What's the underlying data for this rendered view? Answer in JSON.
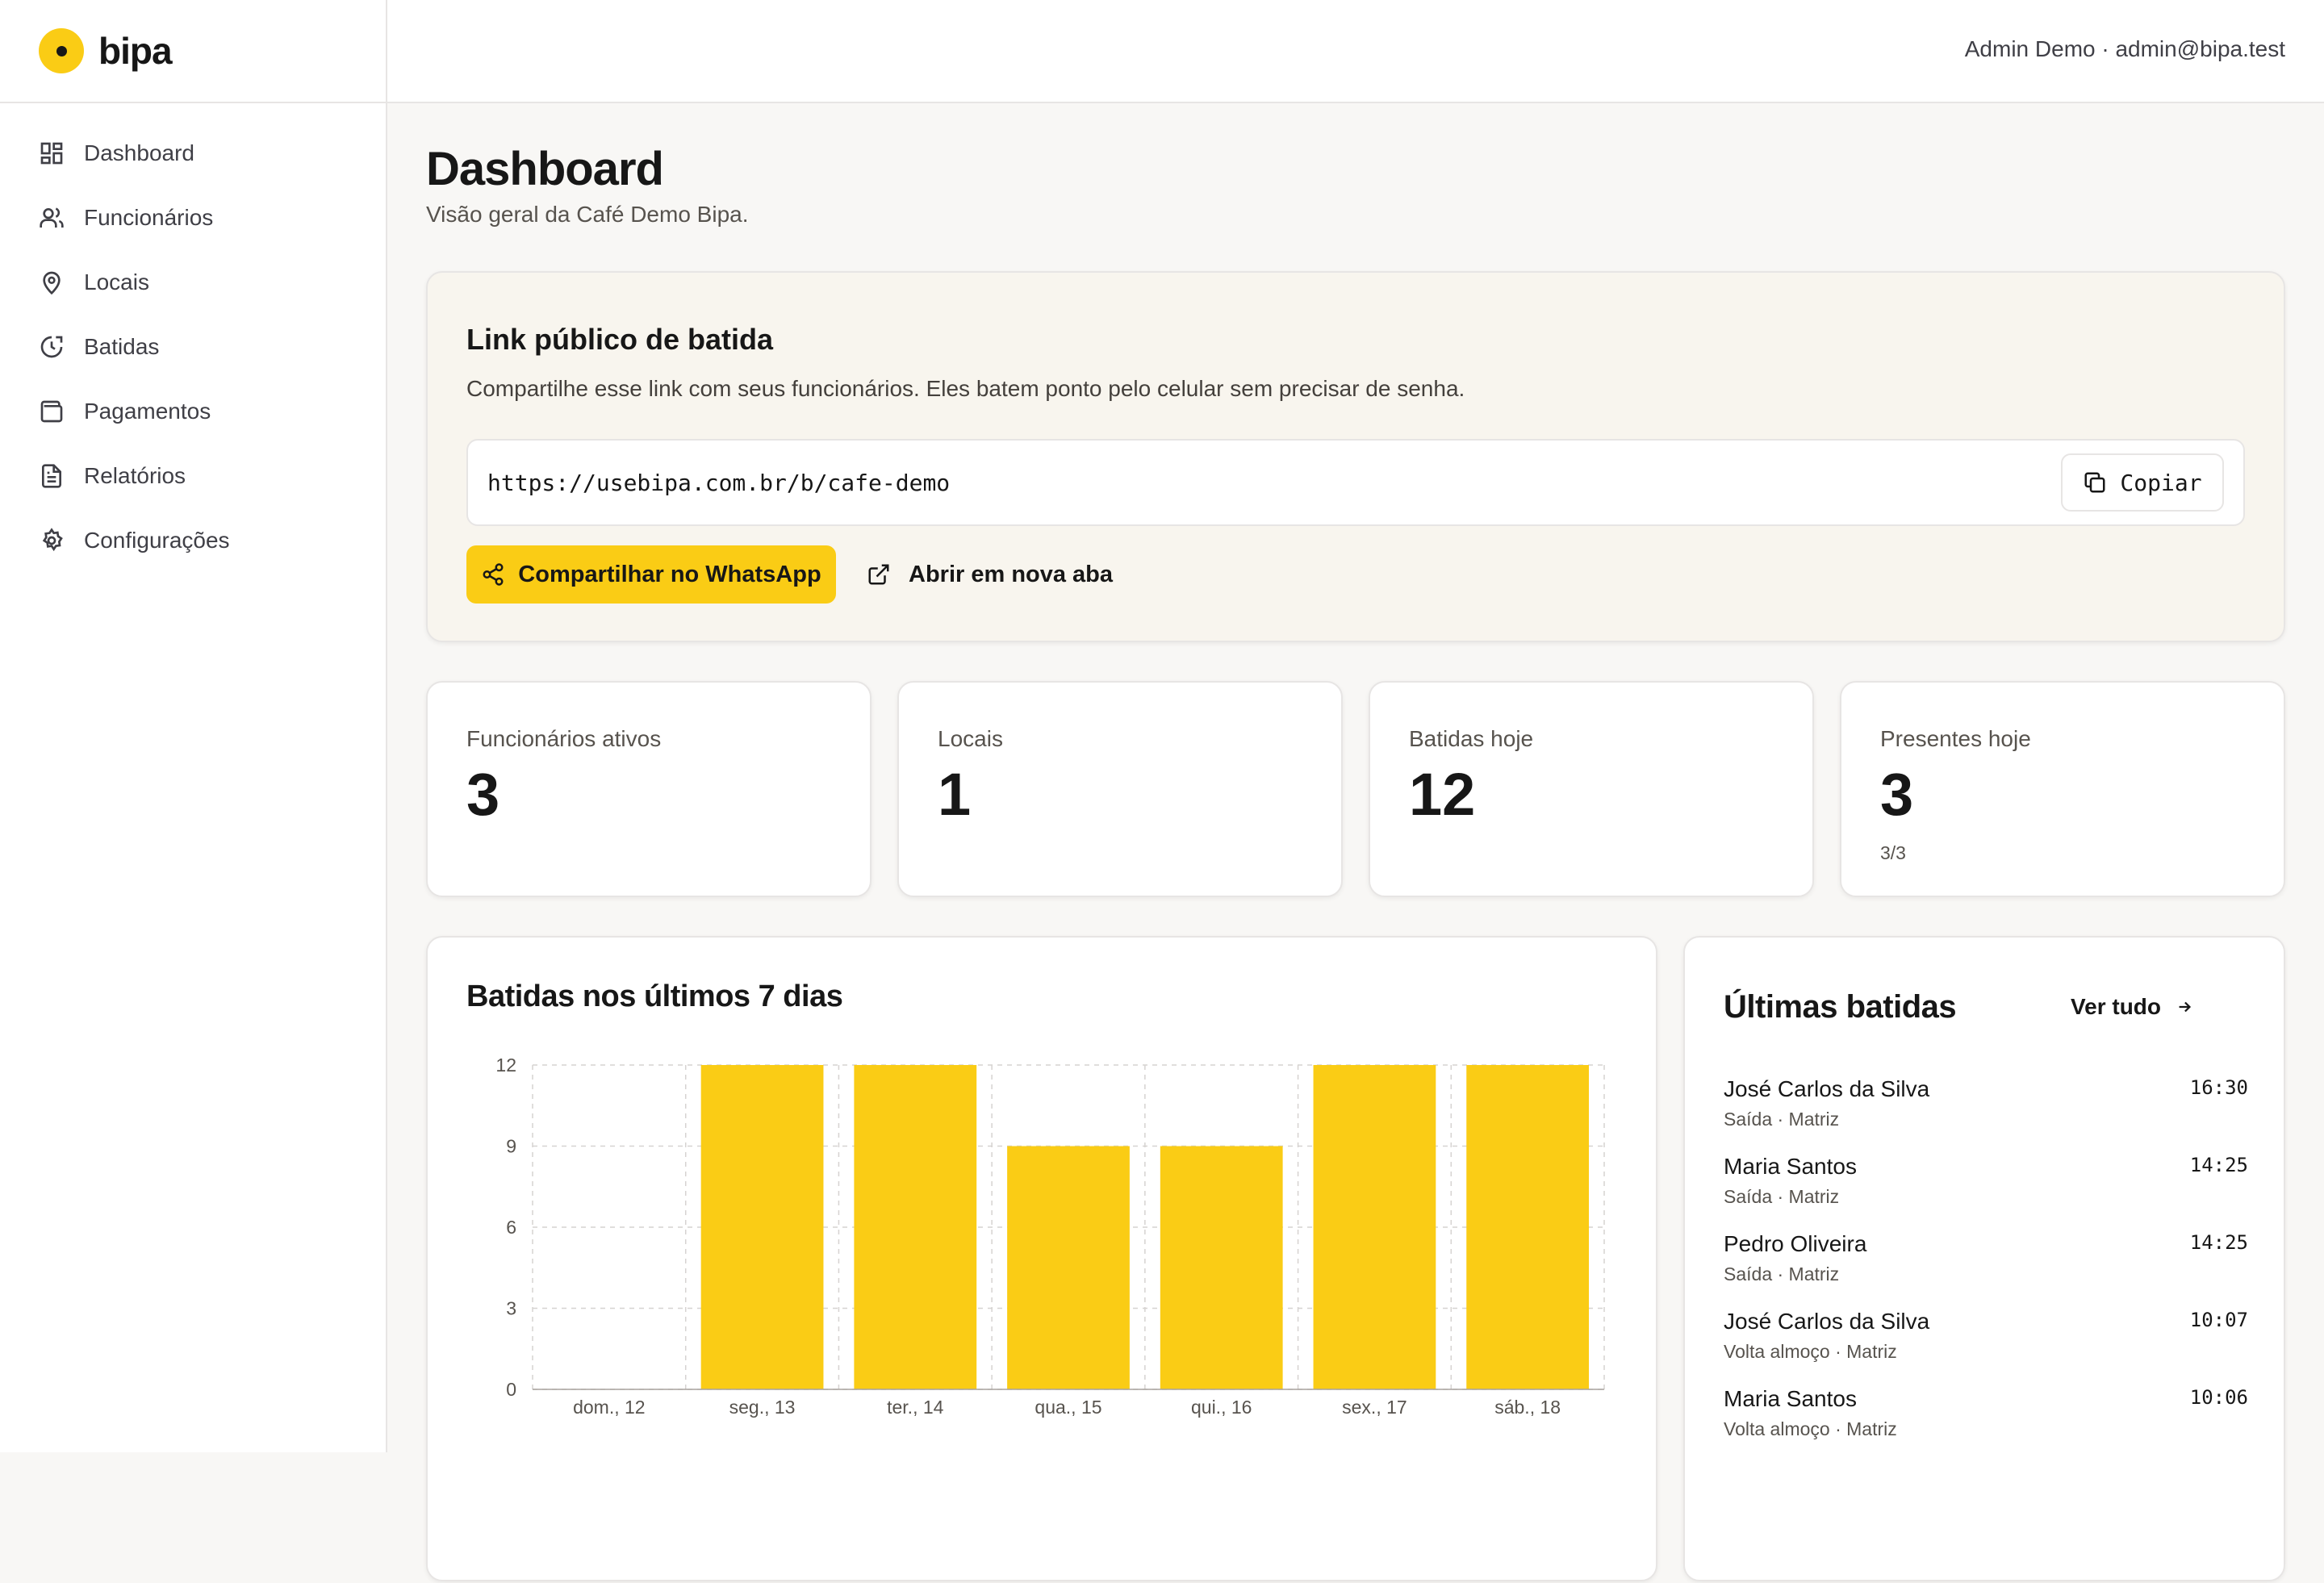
{
  "brand": {
    "name": "bipa"
  },
  "header": {
    "user": "Admin Demo · admin@bipa.test"
  },
  "sidebar": {
    "items": [
      {
        "label": "Dashboard",
        "icon": "dashboard-icon"
      },
      {
        "label": "Funcionários",
        "icon": "users-icon"
      },
      {
        "label": "Locais",
        "icon": "map-pin-icon"
      },
      {
        "label": "Batidas",
        "icon": "clock-icon"
      },
      {
        "label": "Pagamentos",
        "icon": "wallet-icon"
      },
      {
        "label": "Relatórios",
        "icon": "file-text-icon"
      },
      {
        "label": "Configurações",
        "icon": "gear-icon"
      }
    ]
  },
  "page": {
    "title": "Dashboard",
    "subtitle": "Visão geral da Café Demo Bipa."
  },
  "link_card": {
    "title": "Link público de batida",
    "description": "Compartilhe esse link com seus funcionários. Eles batem ponto pelo celular sem precisar de senha.",
    "url": "https://usebipa.com.br/b/cafe-demo",
    "copy_label": "Copiar",
    "whatsapp_label": "Compartilhar no WhatsApp",
    "open_label": "Abrir em nova aba"
  },
  "stats": [
    {
      "label": "Funcionários ativos",
      "value": "3",
      "sub": ""
    },
    {
      "label": "Locais",
      "value": "1",
      "sub": ""
    },
    {
      "label": "Batidas hoje",
      "value": "12",
      "sub": ""
    },
    {
      "label": "Presentes hoje",
      "value": "3",
      "sub": "3/3"
    }
  ],
  "chart_card": {
    "title": "Batidas nos últimos 7 dias"
  },
  "chart_data": {
    "type": "bar",
    "title": "Batidas nos últimos 7 dias",
    "categories": [
      "dom., 12",
      "seg., 13",
      "ter., 14",
      "qua., 15",
      "qui., 16",
      "sex., 17",
      "sáb., 18"
    ],
    "values": [
      0,
      12,
      12,
      9,
      9,
      12,
      12
    ],
    "ylim": [
      0,
      12
    ],
    "yticks": [
      0,
      3,
      6,
      9,
      12
    ],
    "grid": true,
    "bar_color": "#facc15"
  },
  "recent": {
    "title": "Últimas batidas",
    "view_all": "Ver tudo",
    "items": [
      {
        "name": "José Carlos da Silva",
        "meta": "Saída · Matriz",
        "time": "16:30"
      },
      {
        "name": "Maria Santos",
        "meta": "Saída · Matriz",
        "time": "14:25"
      },
      {
        "name": "Pedro Oliveira",
        "meta": "Saída · Matriz",
        "time": "14:25"
      },
      {
        "name": "José Carlos da Silva",
        "meta": "Volta almoço · Matriz",
        "time": "10:07"
      },
      {
        "name": "Maria Santos",
        "meta": "Volta almoço · Matriz",
        "time": "10:06"
      }
    ]
  },
  "colors": {
    "accent": "#facc15",
    "background": "#f8f7f5",
    "link_card_bg": "#f8f5ee"
  }
}
